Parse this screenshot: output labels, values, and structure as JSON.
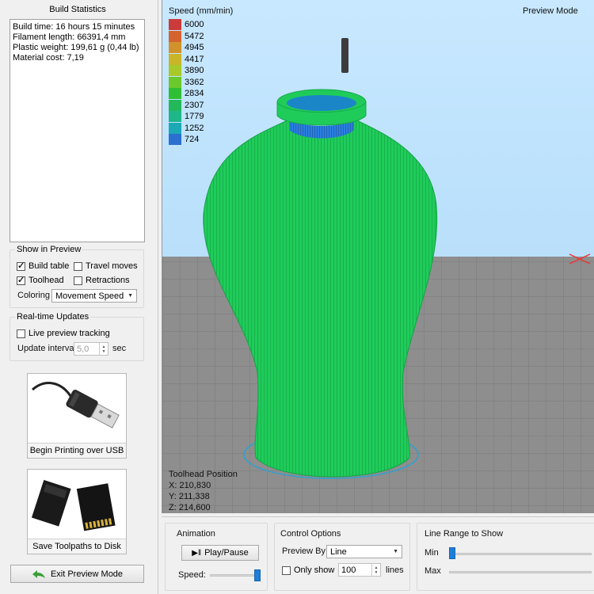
{
  "build_statistics": {
    "title": "Build Statistics",
    "lines": [
      "Build time: 16 hours 15 minutes",
      "Filament length: 66391,4 mm",
      "Plastic weight: 199,61 g (0,44 lb)",
      "Material cost: 7,19"
    ]
  },
  "show_in_preview": {
    "title": "Show in Preview",
    "build_table": {
      "label": "Build table",
      "checked": true
    },
    "travel_moves": {
      "label": "Travel moves",
      "checked": false
    },
    "toolhead": {
      "label": "Toolhead",
      "checked": true
    },
    "retractions": {
      "label": "Retractions",
      "checked": false
    },
    "coloring_label": "Coloring",
    "coloring_value": "Movement Speed"
  },
  "realtime_updates": {
    "title": "Real-time Updates",
    "live_preview": {
      "label": "Live preview tracking",
      "checked": false
    },
    "interval_label": "Update interval",
    "interval_value": "5,0",
    "interval_unit": "sec"
  },
  "buttons": {
    "usb": "Begin Printing over USB",
    "sd": "Save Toolpaths to Disk",
    "exit": "Exit Preview Mode"
  },
  "viewport": {
    "mode_label": "Preview Mode",
    "speed_legend_title": "Speed (mm/min)",
    "speed_legend": [
      {
        "value": "6000",
        "color": "#cc3b3b"
      },
      {
        "value": "5472",
        "color": "#d4632f"
      },
      {
        "value": "4945",
        "color": "#d1922c"
      },
      {
        "value": "4417",
        "color": "#c8b52a"
      },
      {
        "value": "3890",
        "color": "#a8c92a"
      },
      {
        "value": "3362",
        "color": "#6cc92c"
      },
      {
        "value": "2834",
        "color": "#2fbf35"
      },
      {
        "value": "2307",
        "color": "#23b85a"
      },
      {
        "value": "1779",
        "color": "#1fb68a"
      },
      {
        "value": "1252",
        "color": "#1ba9b6"
      },
      {
        "value": "724",
        "color": "#2b6fd0"
      }
    ],
    "toolhead_title": "Toolhead Position",
    "toolhead_x": "X: 210,830",
    "toolhead_y": "Y: 211,338",
    "toolhead_z": "Z: 214,600"
  },
  "animation": {
    "title": "Animation",
    "play_pause": "Play/Pause",
    "speed_label": "Speed:",
    "speed_level": 1.0
  },
  "control_options": {
    "title": "Control Options",
    "preview_by_label": "Preview By",
    "preview_by_value": "Line",
    "only_show": {
      "label": "Only show",
      "checked": false
    },
    "only_show_value": "100",
    "only_show_unit": "lines"
  },
  "line_range": {
    "title": "Line Range to Show",
    "min_label": "Min",
    "max_label": "Max",
    "min_level": 0.0
  },
  "colors": {
    "vase_green": "#1fcc5a",
    "neck_blue": "#2a7fe0",
    "grid_floor": "#8a8a8a",
    "sky": "#b9defa"
  }
}
